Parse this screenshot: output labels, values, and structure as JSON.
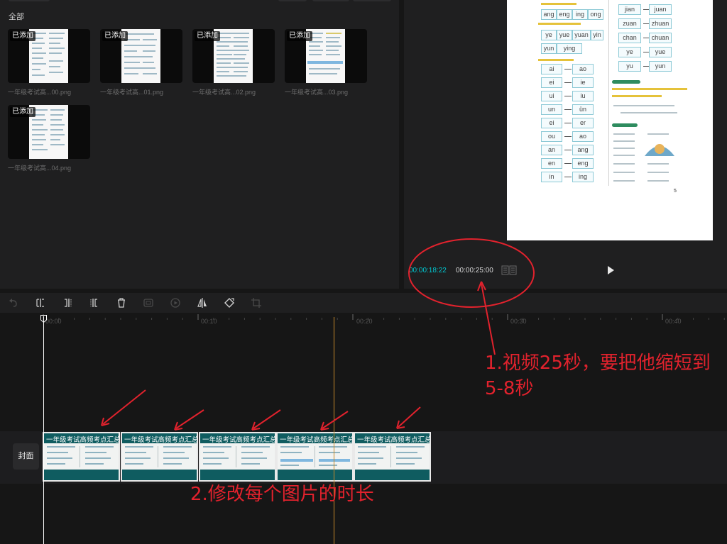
{
  "media": {
    "filter_label": "全部",
    "badge": "已添加",
    "items": [
      {
        "name": "一年级考试高...00.png"
      },
      {
        "name": "一年级考试高...01.png"
      },
      {
        "name": "一年级考试高...02.png"
      },
      {
        "name": "一年级考试高...03.png"
      },
      {
        "name": "一年级考试高...04.png"
      }
    ]
  },
  "player": {
    "current_time": "00:00:18:22",
    "total_time": "00:00:25:00",
    "preview": {
      "left_rows": [
        [
          "ang",
          "eng",
          "ing",
          "ong"
        ],
        [
          "ye",
          "yue",
          "yuan",
          "yin"
        ],
        [
          "yun",
          "ying"
        ]
      ],
      "pairs": [
        [
          "ai",
          "ao"
        ],
        [
          "ei",
          "ie"
        ],
        [
          "ui",
          "iu"
        ],
        [
          "un",
          "ün"
        ],
        [
          "ei",
          "er"
        ],
        [
          "ou",
          "ao"
        ],
        [
          "an",
          "ang"
        ],
        [
          "en",
          "eng"
        ],
        [
          "in",
          "ing"
        ]
      ],
      "right_pairs": [
        [
          "jian",
          "juan"
        ],
        [
          "zuan",
          "zhuan"
        ],
        [
          "chan",
          "chuan"
        ],
        [
          "ye",
          "yue"
        ],
        [
          "yu",
          "yun"
        ]
      ],
      "dash": "—"
    }
  },
  "toolbar": {
    "icons": [
      "undo-icon",
      "split-icon",
      "split-left-icon",
      "split-right-icon",
      "delete-icon",
      "freeze-icon",
      "play-circle-icon",
      "mirror-icon",
      "rotate-icon",
      "crop-icon"
    ]
  },
  "timeline": {
    "ticks": [
      "00:00",
      "00:10",
      "00:20",
      "00:30",
      "00:40"
    ],
    "cover_label": "封面",
    "clips": [
      {
        "name": "一年级考试高频考点汇总"
      },
      {
        "name": "一年级考试高频考点汇总"
      },
      {
        "name": "一年级考试高频考点汇总"
      },
      {
        "name": "一年级考试高频考点汇总"
      },
      {
        "name": "一年级考试高频考点汇总"
      }
    ]
  },
  "annotations": {
    "note1_line1": "1.视频25秒，要把他缩短到",
    "note1_line2": "5-8秒",
    "note2": "2.修改每个图片的时长",
    "color": "#e2222d"
  },
  "colors": {
    "accent_time": "#00c6cf",
    "clip_bg": "#0f5c60",
    "playhead_marker": "#c68a2a"
  }
}
